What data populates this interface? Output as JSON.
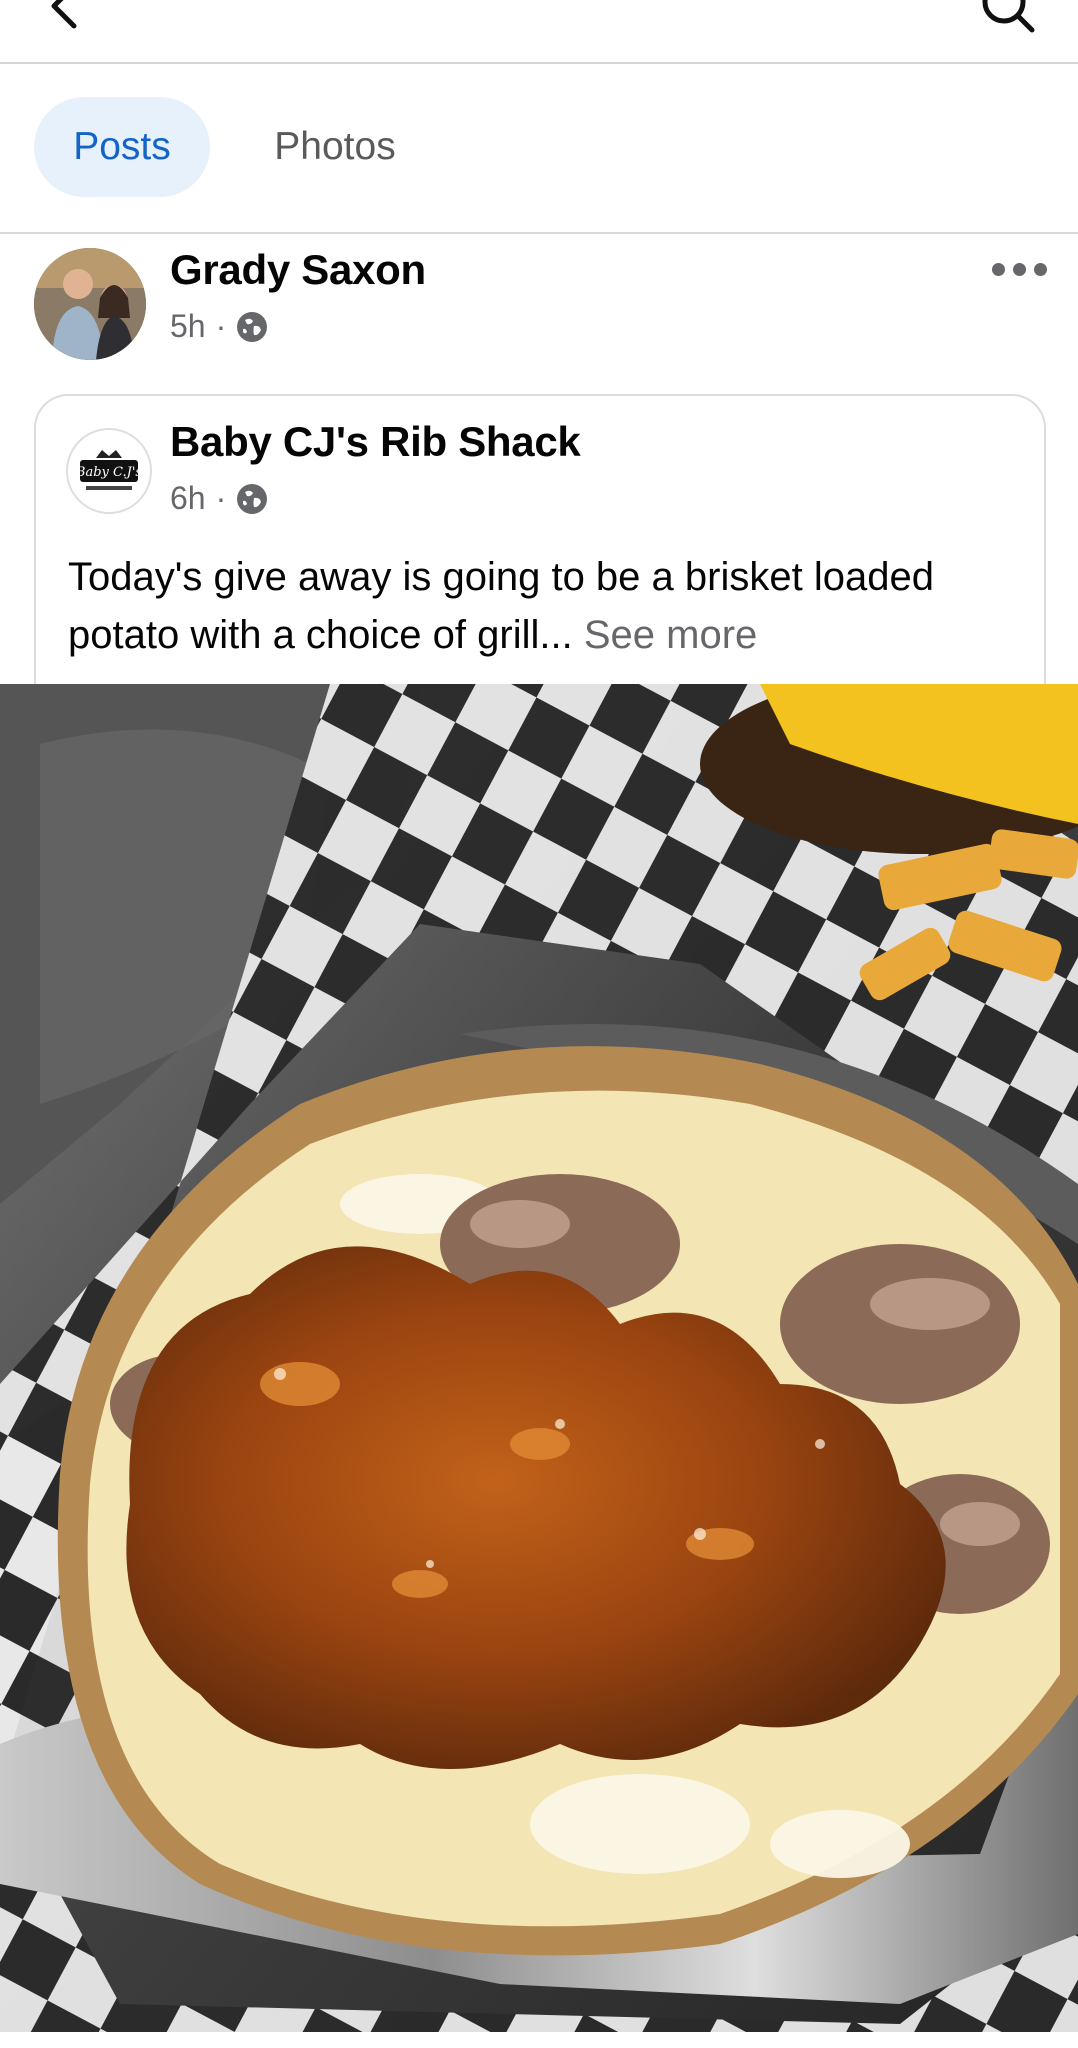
{
  "tabs": [
    {
      "label": "Posts",
      "active": true
    },
    {
      "label": "Photos",
      "active": false
    }
  ],
  "post": {
    "author": "Grady Saxon",
    "time": "5h",
    "separator": "·",
    "privacy_icon": "globe-icon"
  },
  "shared": {
    "page_name": "Baby CJ's Rib Shack",
    "time": "6h",
    "separator": "·",
    "text": "Today's give away is going to be a brisket loaded potato with a choice of grill...",
    "see_more": "See more",
    "logo_text": "Baby C.J's"
  },
  "colors": {
    "accent": "#1464c8",
    "tab_active_bg": "#e7f1fc",
    "meta_gray": "#65676b"
  }
}
